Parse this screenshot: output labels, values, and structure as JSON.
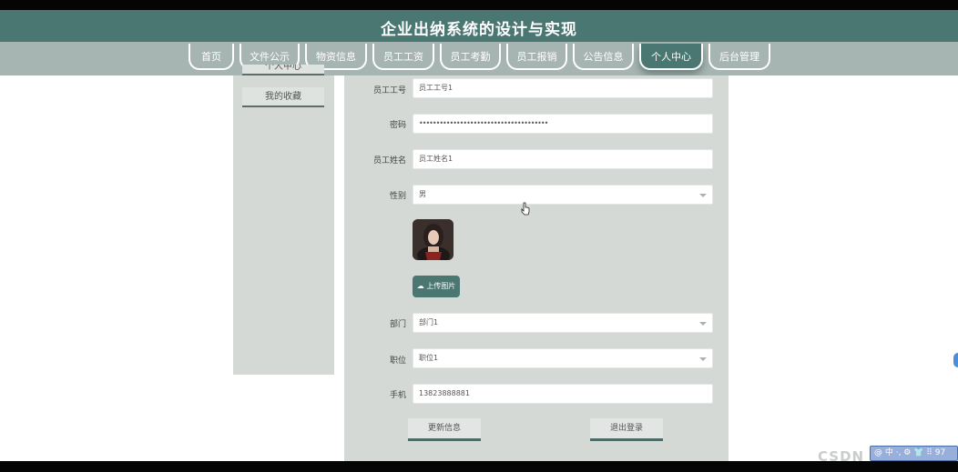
{
  "header": {
    "title": "企业出纳系统的设计与实现"
  },
  "nav": {
    "items": [
      {
        "label": "首页"
      },
      {
        "label": "文件公示"
      },
      {
        "label": "物资信息"
      },
      {
        "label": "员工工资"
      },
      {
        "label": "员工考勤"
      },
      {
        "label": "员工报销"
      },
      {
        "label": "公告信息"
      },
      {
        "label": "个人中心"
      },
      {
        "label": "后台管理"
      }
    ],
    "active": "个人中心"
  },
  "sidebar": {
    "items": [
      {
        "label": "个人中心"
      },
      {
        "label": "我的收藏"
      }
    ]
  },
  "form": {
    "employee_no": {
      "label": "员工工号",
      "value": "员工工号1"
    },
    "password": {
      "label": "密码",
      "value": "••••••••••••••••••••••••••••••••••••••"
    },
    "employee_name": {
      "label": "员工姓名",
      "value": "员工姓名1"
    },
    "gender": {
      "label": "性别",
      "value": "男"
    },
    "upload_label": "上传图片",
    "department": {
      "label": "部门",
      "value": "部门1"
    },
    "position": {
      "label": "职位",
      "value": "职位1"
    },
    "phone": {
      "label": "手机",
      "value": "13823888881"
    },
    "update_button": "更新信息",
    "logout_button": "退出登录"
  },
  "watermark": {
    "text": "CSDN",
    "badge": "@ 中 ·, ⚙ 👕 ⠿ 97"
  },
  "icons": {
    "upload": "cloud-upload-icon",
    "select_caret": "chevron-down-icon",
    "cursor": "mouse-cursor-icon"
  },
  "colors": {
    "header": "#4b7773",
    "navbar": "#a7b5b2",
    "panel": "#d4d9d6",
    "accent": "#4b7773"
  }
}
